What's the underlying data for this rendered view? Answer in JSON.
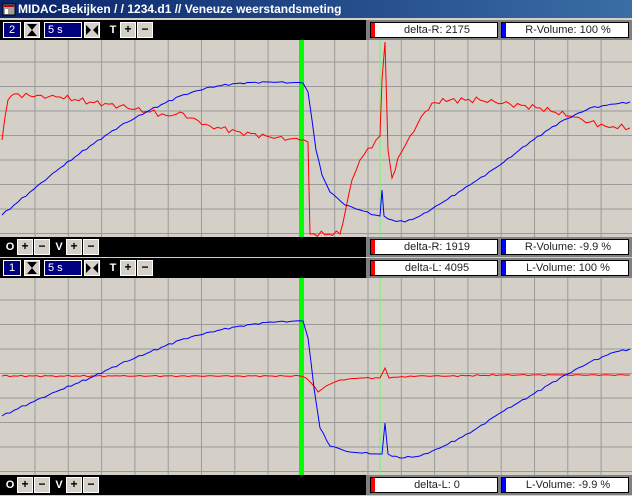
{
  "window": {
    "title": "MIDAC-Bekijken /  / 1234.d1 // Veneuze weerstandsmeting"
  },
  "top_panel": {
    "channel": "2",
    "time": "5 s",
    "t_label": "T",
    "offset_label": "O",
    "v_label": "V",
    "delta_top": "delta-R: 2175",
    "volume_top": "R-Volume: 100 %",
    "delta_bottom": "delta-R: 1919",
    "volume_bottom": "R-Volume: -9.9 %"
  },
  "bottom_panel": {
    "channel": "1",
    "time": "5 s",
    "t_label": "T",
    "offset_label": "O",
    "v_label": "V",
    "delta_top": "delta-L: 4095",
    "volume_top": "L-Volume: 100 %",
    "delta_bottom": "delta-L: 0",
    "volume_bottom": "L-Volume: -9.9 %"
  },
  "colors": {
    "plot_bg": "#d4d0c8",
    "grid": "#9a9a9a",
    "blue_trace": "#0000ff",
    "red_trace": "#ff0000",
    "marker_primary": "#00ff00",
    "marker_secondary": "#66ff66",
    "indicator_red": "#ff0000",
    "indicator_blue": "#0000ff"
  },
  "icons": [
    "app-window-icon",
    "hourglass-icon",
    "compress-icon",
    "plus-icon",
    "minus-icon"
  ]
}
